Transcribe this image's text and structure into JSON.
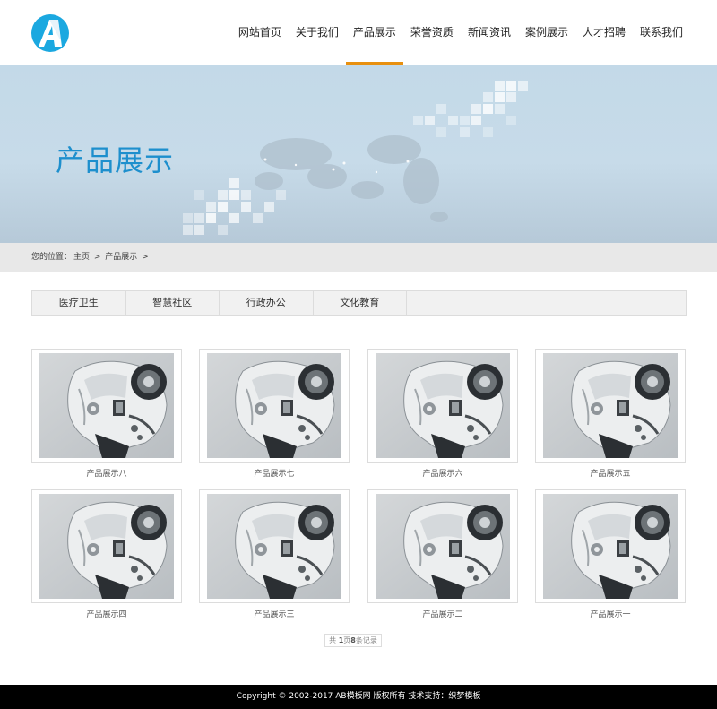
{
  "nav": {
    "items": [
      {
        "label": "网站首页"
      },
      {
        "label": "关于我们"
      },
      {
        "label": "产品展示"
      },
      {
        "label": "荣誉资质"
      },
      {
        "label": "新闻资讯"
      },
      {
        "label": "案例展示"
      },
      {
        "label": "人才招聘"
      },
      {
        "label": "联系我们"
      }
    ],
    "active_index": 2,
    "accent_color": "#e8900f"
  },
  "banner": {
    "title": "产品展示"
  },
  "breadcrumb": {
    "prefix": "您的位置：",
    "home": "主页",
    "sep1": " > ",
    "current": "产品展示",
    "sep2": " >"
  },
  "categories": [
    {
      "label": "医疗卫生"
    },
    {
      "label": "智慧社区"
    },
    {
      "label": "行政办公"
    },
    {
      "label": "文化教育"
    }
  ],
  "products": [
    {
      "name": "产品展示八"
    },
    {
      "name": "产品展示七"
    },
    {
      "name": "产品展示六"
    },
    {
      "name": "产品展示五"
    },
    {
      "name": "产品展示四"
    },
    {
      "name": "产品展示三"
    },
    {
      "name": "产品展示二"
    },
    {
      "name": "产品展示一"
    }
  ],
  "pager": {
    "pre": "共 ",
    "pages": "1",
    "mid": "页",
    "records": "8",
    "post": "条记录"
  },
  "footer": {
    "text": "Copyright © 2002-2017 AB模板网 版权所有   技术支持：织梦模板"
  },
  "colors": {
    "brand_blue": "#1ba8e0",
    "title_blue": "#1d8fcd"
  }
}
